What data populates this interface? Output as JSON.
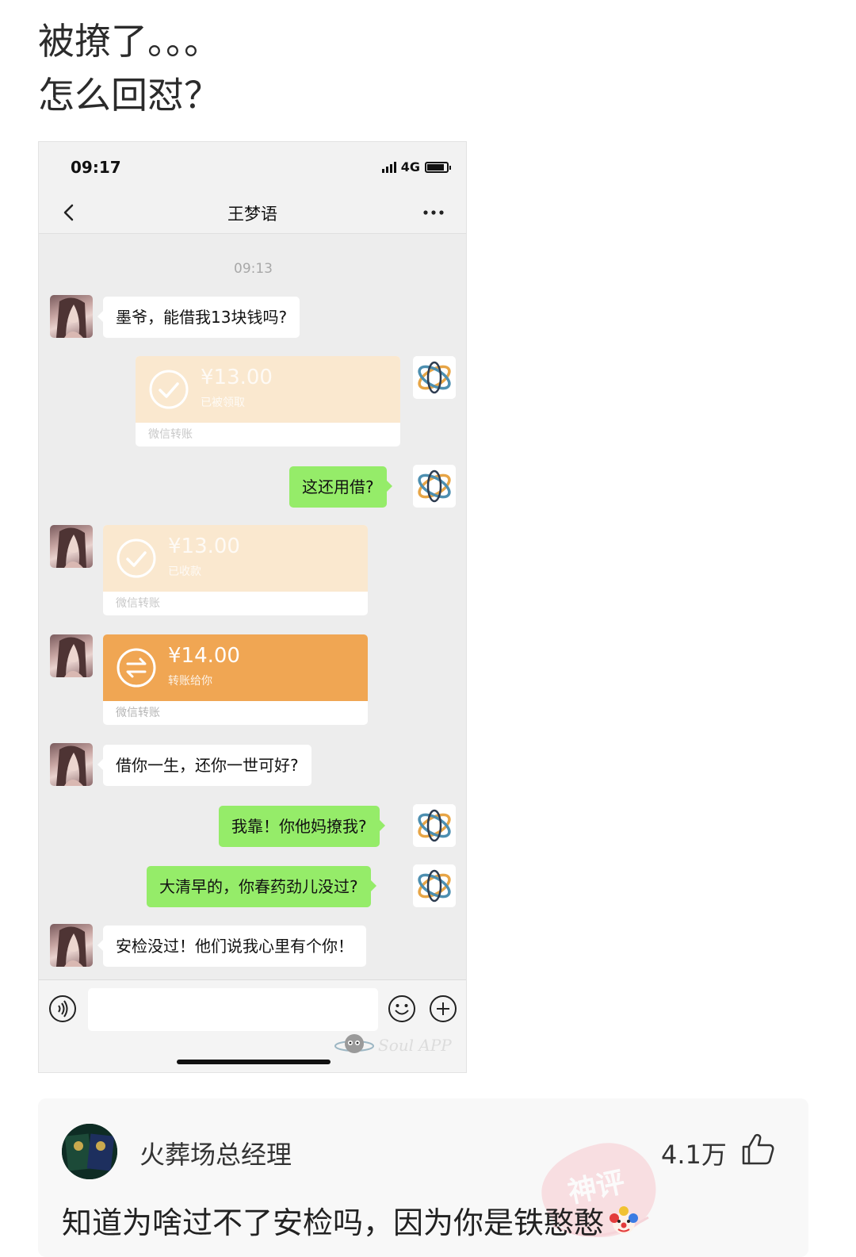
{
  "post": {
    "title_line1": "被撩了。。。",
    "title_line2": "怎么回怼？"
  },
  "phone": {
    "status_time": "09:17",
    "network": "4G",
    "chat_name": "王梦语",
    "timestamp": "09:13",
    "messages": [
      {
        "from": "her",
        "type": "text",
        "text": "墨爷，能借我13块钱吗?"
      },
      {
        "from": "me",
        "type": "transfer",
        "amount": "¥13.00",
        "status": "已被领取",
        "source": "微信转账"
      },
      {
        "from": "me",
        "type": "text",
        "text": "这还用借?"
      },
      {
        "from": "her",
        "type": "transfer",
        "amount": "¥13.00",
        "status": "已收款",
        "source": "微信转账"
      },
      {
        "from": "her",
        "type": "transfer",
        "amount": "¥14.00",
        "status": "转账给你",
        "source": "微信转账"
      },
      {
        "from": "her",
        "type": "text",
        "text": "借你一生，还你一世可好?"
      },
      {
        "from": "me",
        "type": "text",
        "text": "我靠！你他妈撩我?"
      },
      {
        "from": "me",
        "type": "text",
        "text": "大清早的，你春药劲儿没过?"
      },
      {
        "from": "her",
        "type": "text",
        "text": "安检没过！他们说我心里有个你！"
      }
    ],
    "input_placeholder": "",
    "watermark": "Soul APP"
  },
  "comment": {
    "username": "火葬场总经理",
    "likes": "4.1万",
    "text": "知道为啥过不了安检吗，因为你是铁憨憨",
    "stamp": "神评"
  },
  "colors": {
    "sent_bubble": "#95ec69",
    "transfer_active": "#f0a653",
    "transfer_faded": "#fae8cf",
    "chat_bg": "#ededed"
  },
  "icons": [
    "back-icon",
    "more-icon",
    "voice-icon",
    "emoji-icon",
    "plus-icon",
    "like-icon",
    "clown-icon"
  ]
}
